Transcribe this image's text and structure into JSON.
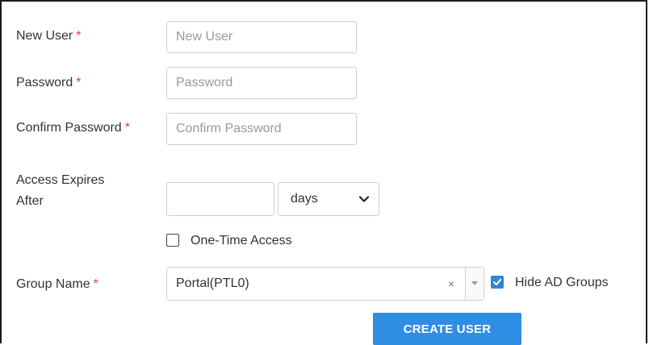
{
  "form": {
    "new_user": {
      "label": "New User",
      "required_mark": "*",
      "placeholder": "New User",
      "value": ""
    },
    "password": {
      "label": "Password",
      "required_mark": "*",
      "placeholder": "Password",
      "value": ""
    },
    "confirm_password": {
      "label": "Confirm Password",
      "required_mark": "*",
      "placeholder": "Confirm Password",
      "value": ""
    },
    "access_expires": {
      "label_line1": "Access Expires",
      "label_line2": "After",
      "value": "",
      "unit_selected": "days"
    },
    "one_time_access": {
      "label": "One-Time Access",
      "checked": false
    },
    "group_name": {
      "label": "Group Name",
      "required_mark": "*",
      "selected": "Portal(PTL0)",
      "clear_glyph": "×"
    },
    "hide_ad_groups": {
      "label": "Hide AD Groups",
      "checked": true
    },
    "submit_label": "CREATE USER"
  },
  "colors": {
    "accent": "#2f8de4",
    "required": "#e0403a",
    "checkbox_checked": "#2f86d4"
  },
  "icons": {
    "select_arrow": "chevron-down-icon",
    "clear": "close-icon",
    "check": "check-icon"
  }
}
